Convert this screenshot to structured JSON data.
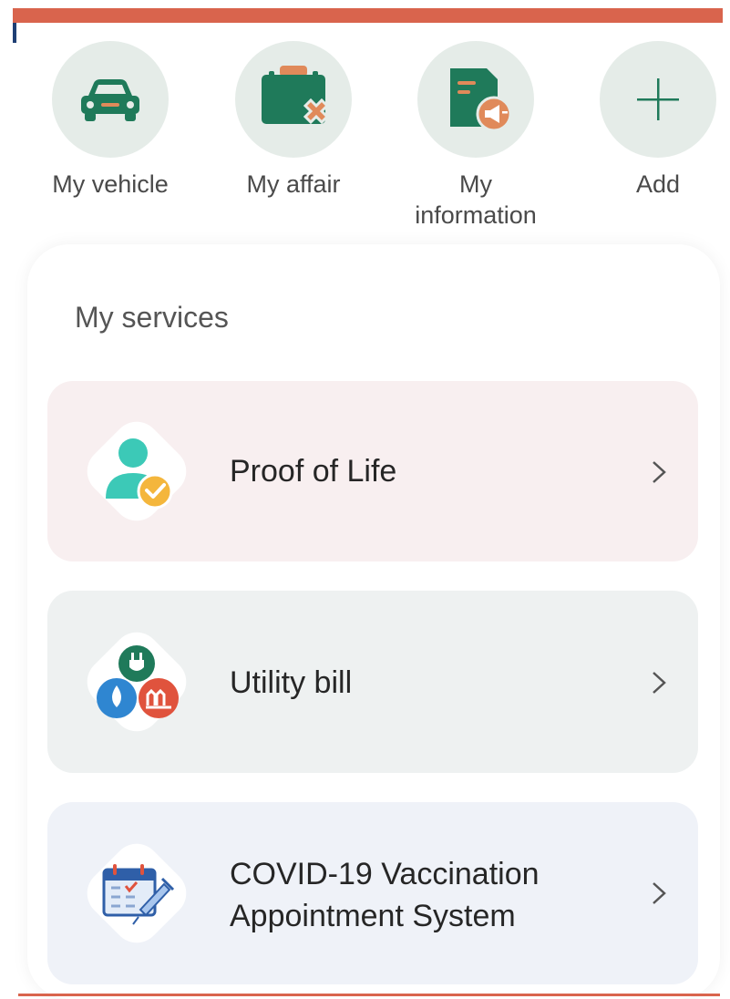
{
  "shortcuts": [
    {
      "label": "My vehicle",
      "icon": "car-icon"
    },
    {
      "label": "My affair",
      "icon": "briefcase-icon"
    },
    {
      "label": "My information",
      "icon": "notice-document-icon"
    },
    {
      "label": "Add",
      "icon": "plus-icon"
    }
  ],
  "services": {
    "title": "My services",
    "items": [
      {
        "label": "Proof of Life",
        "icon": "person-check-icon",
        "background": "#f8eff0"
      },
      {
        "label": "Utility bill",
        "icon": "utility-icon",
        "background": "#eef1f1"
      },
      {
        "label": "COVID-19 Vaccination Appointment System",
        "icon": "calendar-vaccine-icon",
        "background": "#eff2f8"
      }
    ]
  },
  "colors": {
    "accent_bar": "#d9644d",
    "icon_green": "#1f7a5a",
    "icon_orange": "#e08a5a",
    "teal": "#3cc9b7"
  }
}
